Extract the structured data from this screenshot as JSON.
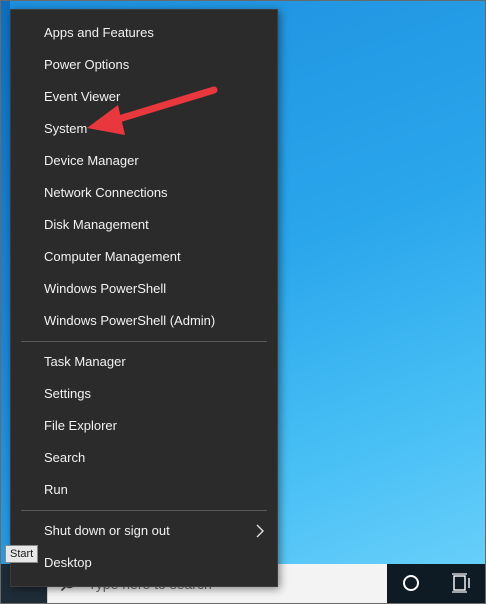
{
  "menu": {
    "group1": [
      {
        "label": "Apps and Features"
      },
      {
        "label": "Power Options"
      },
      {
        "label": "Event Viewer"
      },
      {
        "label": "System"
      },
      {
        "label": "Device Manager"
      },
      {
        "label": "Network Connections"
      },
      {
        "label": "Disk Management"
      },
      {
        "label": "Computer Management"
      },
      {
        "label": "Windows PowerShell"
      },
      {
        "label": "Windows PowerShell (Admin)"
      }
    ],
    "group2": [
      {
        "label": "Task Manager"
      },
      {
        "label": "Settings"
      },
      {
        "label": "File Explorer"
      },
      {
        "label": "Search"
      },
      {
        "label": "Run"
      }
    ],
    "group3": [
      {
        "label": "Shut down or sign out"
      },
      {
        "label": "Desktop"
      }
    ]
  },
  "taskbar": {
    "start_tooltip": "Start",
    "search_placeholder": "Type here to search"
  },
  "colors": {
    "menu_bg": "#2b2b2b",
    "menu_text": "#f2f2f2",
    "annotation_arrow": "#e8383d",
    "desktop_blue": "#2aa6ec",
    "taskbar": "#0e1a24"
  },
  "icons": {
    "cortana": "cortana-circle-icon",
    "task_view": "task-view-icon",
    "submenu": "chevron-right-icon",
    "search": "search-icon"
  }
}
